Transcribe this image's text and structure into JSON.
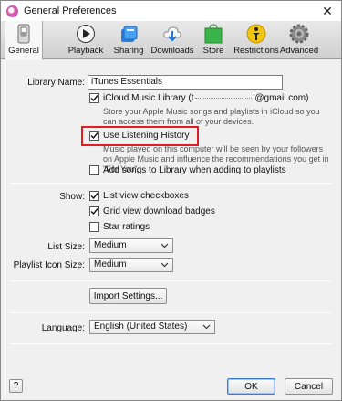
{
  "window": {
    "title": "General Preferences",
    "close_glyph": "✕"
  },
  "toolbar": {
    "tabs": [
      {
        "label": "General",
        "icon": "switch-icon",
        "active": true
      },
      {
        "label": "Playback",
        "icon": "play-icon",
        "active": false
      },
      {
        "label": "Sharing",
        "icon": "sharing-icon",
        "active": false
      },
      {
        "label": "Downloads",
        "icon": "download-cloud-icon",
        "active": false
      },
      {
        "label": "Store",
        "icon": "store-bag-icon",
        "active": false
      },
      {
        "label": "Restrictions",
        "icon": "restrictions-icon",
        "active": false
      },
      {
        "label": "Advanced",
        "icon": "gear-icon",
        "active": false
      }
    ]
  },
  "library": {
    "name_label": "Library Name:",
    "name_value": "iTunes Essentials",
    "icloud_label": "iCloud Music Library (t",
    "icloud_email_suffix": "'@gmail.com)",
    "icloud_checked": true,
    "icloud_desc": "Store your Apple Music songs and playlists in iCloud so you can access them from all of your devices.",
    "listening_label": "Use Listening History",
    "listening_checked": true,
    "listening_desc": "Music played on this computer will be seen by your followers on Apple Music and influence the recommendations you get in \"For You\".",
    "add_songs_label": "Add songs to Library when adding to playlists",
    "add_songs_checked": false
  },
  "show": {
    "label": "Show:",
    "list_view_label": "List view checkboxes",
    "list_view_checked": true,
    "grid_badges_label": "Grid view download badges",
    "grid_badges_checked": true,
    "star_ratings_label": "Star ratings",
    "star_ratings_checked": false
  },
  "sizes": {
    "list_size_label": "List Size:",
    "list_size_value": "Medium",
    "playlist_icon_label": "Playlist Icon Size:",
    "playlist_icon_value": "Medium"
  },
  "import_button": "Import Settings...",
  "language": {
    "label": "Language:",
    "value": "English (United States)"
  },
  "footer": {
    "help": "?",
    "ok": "OK",
    "cancel": "Cancel"
  },
  "colors": {
    "highlight": "#e31b23",
    "accent": "#3a7bd5"
  }
}
